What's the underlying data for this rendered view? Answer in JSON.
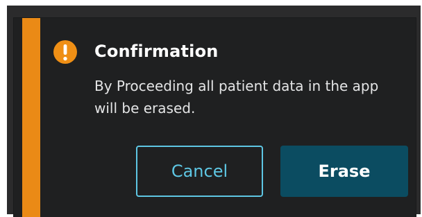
{
  "dialog": {
    "title": "Confirmation",
    "message": "By Proceeding all patient data in the app will be erased.",
    "icon": "exclamation-icon",
    "accent_color": "#ea8a16",
    "cancel_label": "Cancel",
    "erase_label": "Erase"
  }
}
